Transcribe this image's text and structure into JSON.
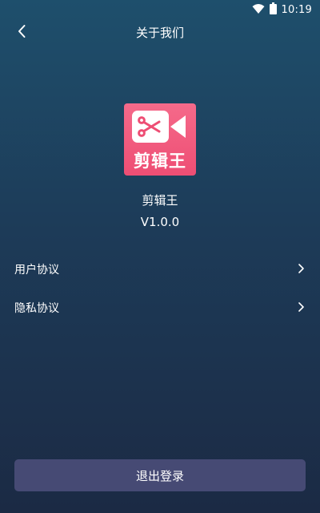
{
  "status_bar": {
    "time": "10:19",
    "icons": [
      "wifi-icon",
      "battery-icon"
    ]
  },
  "nav": {
    "title": "关于我们",
    "back_icon": "chevron-left-icon"
  },
  "app": {
    "logo_text": "剪辑王",
    "logo_icon": "video-scissors-icon",
    "name": "剪辑王",
    "version": "V1.0.0"
  },
  "menu": {
    "items": [
      {
        "label": "用户协议",
        "icon": "chevron-right-icon"
      },
      {
        "label": "隐私协议",
        "icon": "chevron-right-icon"
      }
    ]
  },
  "logout": {
    "label": "退出登录"
  },
  "colors": {
    "background_top": "#1e4f6c",
    "background_bottom": "#1b2a44",
    "logo_bg": "#ee4e74",
    "logout_bg": "#464a74",
    "text": "#ffffff"
  }
}
